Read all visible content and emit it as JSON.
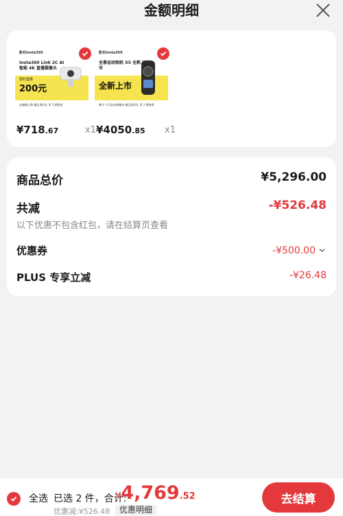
{
  "header": {
    "title": "金额明细"
  },
  "products": [
    {
      "brand": "影石Insta360",
      "title": "Insta360 Link 2C AI 智能 4K 直播摄像头",
      "sub": "限时直降",
      "big": "200元",
      "foot": "店铺随心购  赠品享好礼  享 3 期免息",
      "price_int": "¥718",
      "price_dec": ".67",
      "qty": "x1"
    },
    {
      "brand": "影石Insta360",
      "title": "全景运动相机 X5 全新上市",
      "sub": "",
      "big": "全新上市",
      "foot": "赠 4 个月云存储服务  赠品享好礼  享 3 期免息",
      "price_int": "¥4050",
      "price_dec": ".85",
      "qty": "x1"
    }
  ],
  "summary": {
    "total_label": "商品总价",
    "total_value": "¥5,296.00",
    "reduce_label": "共减",
    "reduce_value": "-¥526.48",
    "note": "以下优惠不包含红包，请在结算页查看",
    "coupon_label": "优惠券",
    "coupon_value": "-¥500.00",
    "plus_label": "PLUS 专享立减",
    "plus_value": "-¥26.48"
  },
  "bottom": {
    "select_all": "全选",
    "selected": "已选 2 件，合计:",
    "currency": "¥",
    "total_int": "4,769",
    "total_dec": ".52",
    "discount": "优惠减:¥526.48",
    "detail": "优惠明细",
    "checkout": "去结算"
  },
  "colors": {
    "accent": "#e4393c",
    "highlight": "#f5e34f"
  }
}
